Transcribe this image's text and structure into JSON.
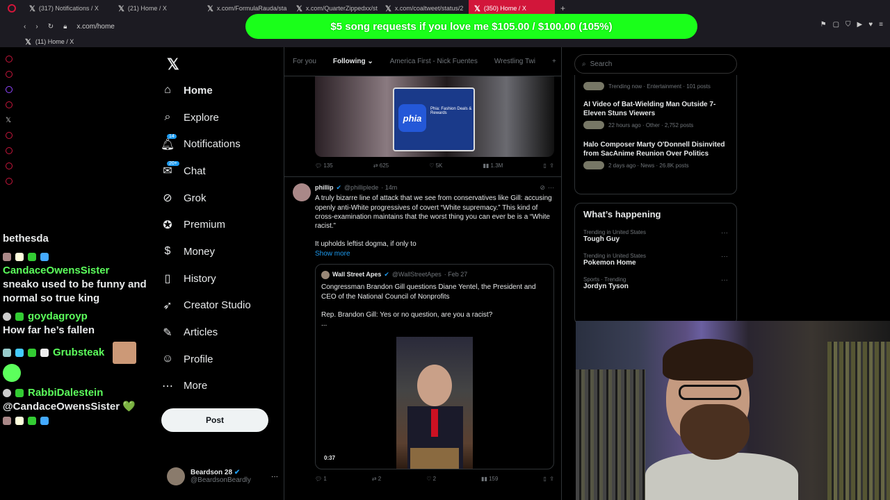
{
  "browser": {
    "tabs": [
      {
        "label": "(317) Notifications / X"
      },
      {
        "label": "(21) Home / X"
      },
      {
        "label": "x.com/FormulaRauda/sta"
      },
      {
        "label": "x.com/QuarterZippedxx/st"
      },
      {
        "label": "x.com/coaltweet/status/2"
      },
      {
        "label": "(350) Home / X"
      }
    ],
    "url": "x.com/home",
    "bookmark": "(11) Home / X",
    "accent": "#d2163a"
  },
  "overlay": {
    "banner": "$5 song requests if you love me $105.00 / $100.00 (105%)",
    "banner_color": "#1aff1a",
    "goal_progress_percent": 105
  },
  "nav": {
    "items": [
      {
        "label": "Home",
        "icon": "home-icon"
      },
      {
        "label": "Explore",
        "icon": "search-icon"
      },
      {
        "label": "Notifications",
        "icon": "bell-icon",
        "badge": "14"
      },
      {
        "label": "Chat",
        "icon": "chat-icon",
        "badge": "20+"
      },
      {
        "label": "Grok",
        "icon": "grok-icon"
      },
      {
        "label": "Premium",
        "icon": "premium-icon"
      },
      {
        "label": "Money",
        "icon": "money-icon"
      },
      {
        "label": "History",
        "icon": "bookmark-icon"
      },
      {
        "label": "Creator Studio",
        "icon": "rocket-icon"
      },
      {
        "label": "Articles",
        "icon": "article-icon"
      },
      {
        "label": "Profile",
        "icon": "person-icon"
      },
      {
        "label": "More",
        "icon": "more-icon"
      }
    ],
    "post_button": "Post",
    "account": {
      "name": "Beardson 28",
      "handle": "@BeardsonBeardly"
    }
  },
  "chat": [
    {
      "user": "",
      "msg": "bethesda"
    },
    {
      "user": "CandaceOwensSister",
      "msg": "sneako used to be funny and normal so true king"
    },
    {
      "user": "goydagroyp",
      "msg": "How far he’s fallen"
    },
    {
      "user": "Grubsteak",
      "msg": ""
    },
    {
      "user": "RabbiDalestein",
      "msg": "@CandaceOwensSister 💚"
    }
  ],
  "timeline": {
    "tabs": [
      "For you",
      "Following",
      "America First - Nick Fuentes",
      "Wrestling Twi"
    ],
    "active_tab": "Following",
    "tweet1": {
      "phone_text": "Phia: Fashion Deals & Rewards",
      "replies": "135",
      "reposts": "625",
      "likes": "5K",
      "views": "1.3M"
    },
    "tweet2": {
      "name": "phillip",
      "handle": "@philliplede",
      "time": "· 14m",
      "text": "A truly bizarre line of attack that we see from conservatives like Gill: accusing openly anti-White progressives of covert “White supremacy.” This kind of cross-examination maintains that the worst thing you can ever be is a “White racist.”",
      "text2": "It upholds leftist dogma, if only to",
      "show_more": "Show more",
      "quote": {
        "name": "Wall Street Apes",
        "handle": "@WallStreetApes",
        "date": "· Feb 27",
        "text": "Congressman Brandon Gill questions Diane Yentel, the President and CEO of the National Council of Nonprofits",
        "text2": "Rep. Brandon Gill: Yes or no question, are you a racist?",
        "text3": "...",
        "duration": "0:37"
      },
      "replies": "1",
      "reposts": "2",
      "likes": "2",
      "views": "159"
    }
  },
  "right": {
    "search_placeholder": "Search",
    "news": [
      {
        "title": "",
        "meta": "Trending now · Entertainment · 101 posts"
      },
      {
        "title": "AI Video of Bat-Wielding Man Outside 7-Eleven Stuns Viewers",
        "meta": "22 hours ago · Other · 2,752 posts"
      },
      {
        "title": "Halo Composer Marty O'Donnell Disinvited from SacAnime Reunion Over Politics",
        "meta": "2 days ago · News · 26.8K posts"
      }
    ],
    "whats_happening": "What’s happening",
    "trends": [
      {
        "cat": "Trending in United States",
        "title": "Tough Guy"
      },
      {
        "cat": "Trending in United States",
        "title": "Pokemon Home"
      },
      {
        "cat": "Sports · Trending",
        "title": "Jordyn Tyson"
      }
    ]
  }
}
